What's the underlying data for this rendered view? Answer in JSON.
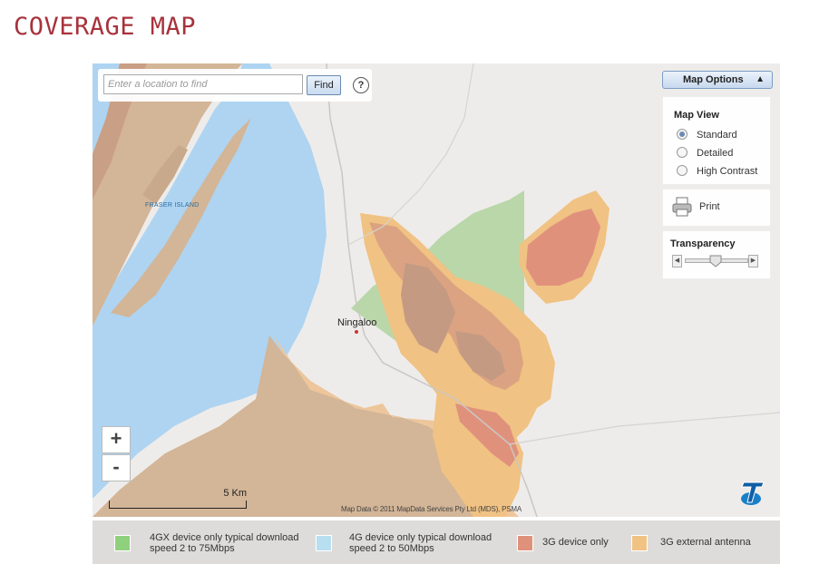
{
  "page": {
    "title": "COVERAGE MAP"
  },
  "search": {
    "placeholder": "Enter a location to find",
    "find_label": "Find",
    "help_label": "?"
  },
  "options": {
    "toggle_label": "Map Options",
    "toggle_arrow": "▲",
    "map_view": {
      "heading": "Map View",
      "choices": [
        "Standard",
        "Detailed",
        "High Contrast"
      ],
      "selected": "Standard"
    },
    "print_label": "Print",
    "transparency": {
      "label": "Transparency",
      "level": 0.5
    }
  },
  "map": {
    "town": "Ningaloo",
    "island": "FRASER ISLAND",
    "scale_label": "5 Km",
    "attribution": "Map Data © 2011 MapData Services Pty Ltd (MDS), PSMA",
    "zoom_in": "+",
    "zoom_out": "-",
    "colors": {
      "water": "#aed4f1",
      "land": "#d3b597",
      "background": "#eeecea"
    }
  },
  "legend": [
    {
      "text": "4GX device only typical download speed 2 to 75Mbps",
      "line1": "4GX device only typical download",
      "line2": "speed 2 to 75Mbps",
      "color": "#8fd07c"
    },
    {
      "text": "4G device only typical download speed 2 to 50Mbps",
      "line1": "4G device only typical download",
      "line2": "speed 2 to 50Mbps",
      "color": "#b8dff0"
    },
    {
      "text": "3G device only",
      "line1": "3G device only",
      "line2": "",
      "color": "#e0917b"
    },
    {
      "text": "3G external antenna",
      "line1": "3G external antenna",
      "line2": "",
      "color": "#f0c283"
    }
  ]
}
